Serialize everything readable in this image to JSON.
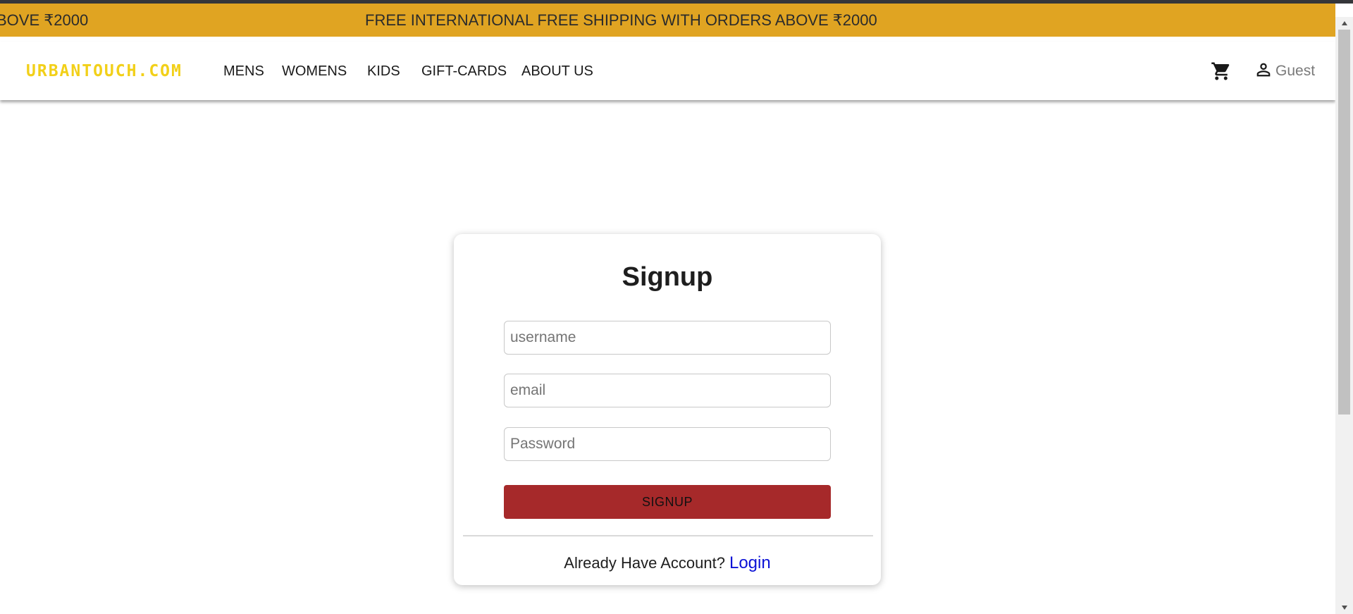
{
  "announcement": {
    "text_partial": "BOVE ₹2000",
    "text": "FREE INTERNATIONAL FREE SHIPPING WITH ORDERS ABOVE ₹2000",
    "background": "#e0a422"
  },
  "header": {
    "logo": "URBANTOUCH.COM",
    "logo_color": "#f2d019",
    "nav": [
      {
        "label": "MENS"
      },
      {
        "label": "WOMENS"
      },
      {
        "label": "KIDS"
      },
      {
        "label": "GIFT-CARDS"
      },
      {
        "label": "ABOUT US"
      }
    ],
    "cart_icon": "cart-icon",
    "user_icon": "person-icon",
    "user_label": "Guest"
  },
  "signup": {
    "title": "Signup",
    "username_placeholder": "username",
    "email_placeholder": "email",
    "password_placeholder": "Password",
    "button_label": "SIGNUP",
    "button_color": "#a6292a",
    "footer_text": "Already Have Account?",
    "login_link": "Login",
    "link_color": "#0b12d6"
  }
}
